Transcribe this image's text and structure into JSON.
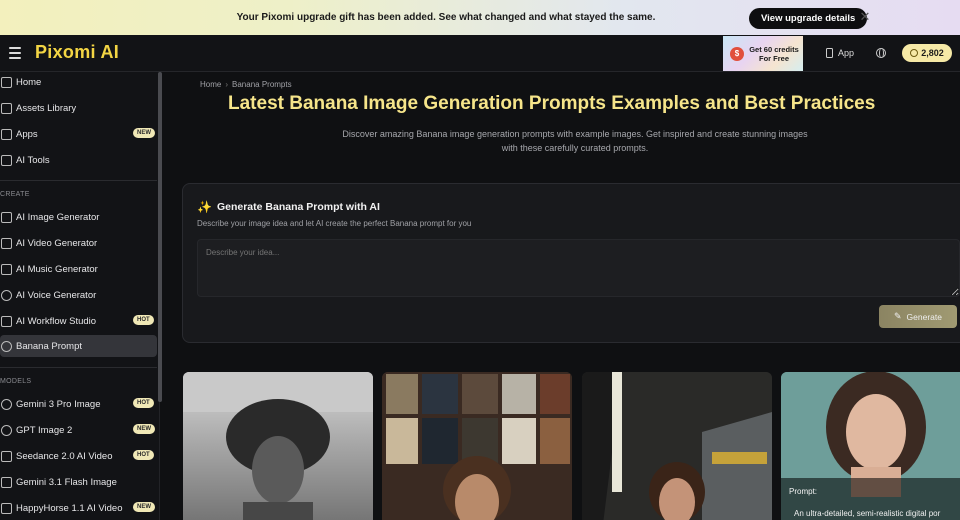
{
  "banner": {
    "text": "Your Pixomi upgrade gift has been added. See what changed and what stayed the same.",
    "button_label": "View upgrade details",
    "close_glyph": "✕"
  },
  "header": {
    "logo": "Pixomi AI",
    "promo_text": "Get 60 credits For Free",
    "promo_icon_glyph": "$",
    "app_label": "App",
    "credits": "2,802"
  },
  "sidebar": {
    "top_items": [
      {
        "label": "Home",
        "icon": "home-icon"
      },
      {
        "label": "Assets Library",
        "icon": "folder-icon"
      },
      {
        "label": "Apps",
        "icon": "apps-icon",
        "badge": "NEW"
      },
      {
        "label": "AI Tools",
        "icon": "tools-icon"
      }
    ],
    "create_section": "CREATE",
    "create_items": [
      {
        "label": "AI Image Generator",
        "icon": "image-icon"
      },
      {
        "label": "AI Video Generator",
        "icon": "video-icon"
      },
      {
        "label": "AI Music Generator",
        "icon": "music-icon"
      },
      {
        "label": "AI Voice Generator",
        "icon": "mic-icon"
      },
      {
        "label": "AI Workflow Studio",
        "icon": "workflow-icon",
        "badge": "HOT"
      },
      {
        "label": "Banana Prompt",
        "icon": "bulb-icon",
        "active": true
      }
    ],
    "models_section": "MODELS",
    "model_items": [
      {
        "label": "Gemini 3 Pro Image",
        "icon": "google-icon",
        "badge": "HOT"
      },
      {
        "label": "GPT Image 2",
        "icon": "openai-icon",
        "badge": "NEW"
      },
      {
        "label": "Seedance 2.0 AI Video",
        "icon": "seedance-icon",
        "badge": "HOT"
      },
      {
        "label": "Gemini 3.1 Flash Image",
        "icon": "image-icon"
      },
      {
        "label": "HappyHorse 1.1 AI Video",
        "icon": "horse-icon",
        "badge": "NEW"
      }
    ]
  },
  "main": {
    "breadcrumb_home": "Home",
    "breadcrumb_sep": "›",
    "breadcrumb_current": "Banana Prompts",
    "title": "Latest Banana Image Generation Prompts Examples and Best Practices",
    "subtitle": "Discover amazing Banana image generation prompts with example images. Get inspired and create stunning images with these carefully curated prompts.",
    "generator": {
      "title": "Generate Banana Prompt with AI",
      "sparkle_glyph": "✨",
      "description": "Describe your image idea and let AI create the perfect Banana prompt for you",
      "placeholder": "Describe your idea...",
      "button_label": "Generate",
      "wand_glyph": "✎"
    },
    "gallery": {
      "overlay_label": "Prompt:",
      "overlay_text": "An ultra-detailed, semi-realistic digital por"
    }
  }
}
